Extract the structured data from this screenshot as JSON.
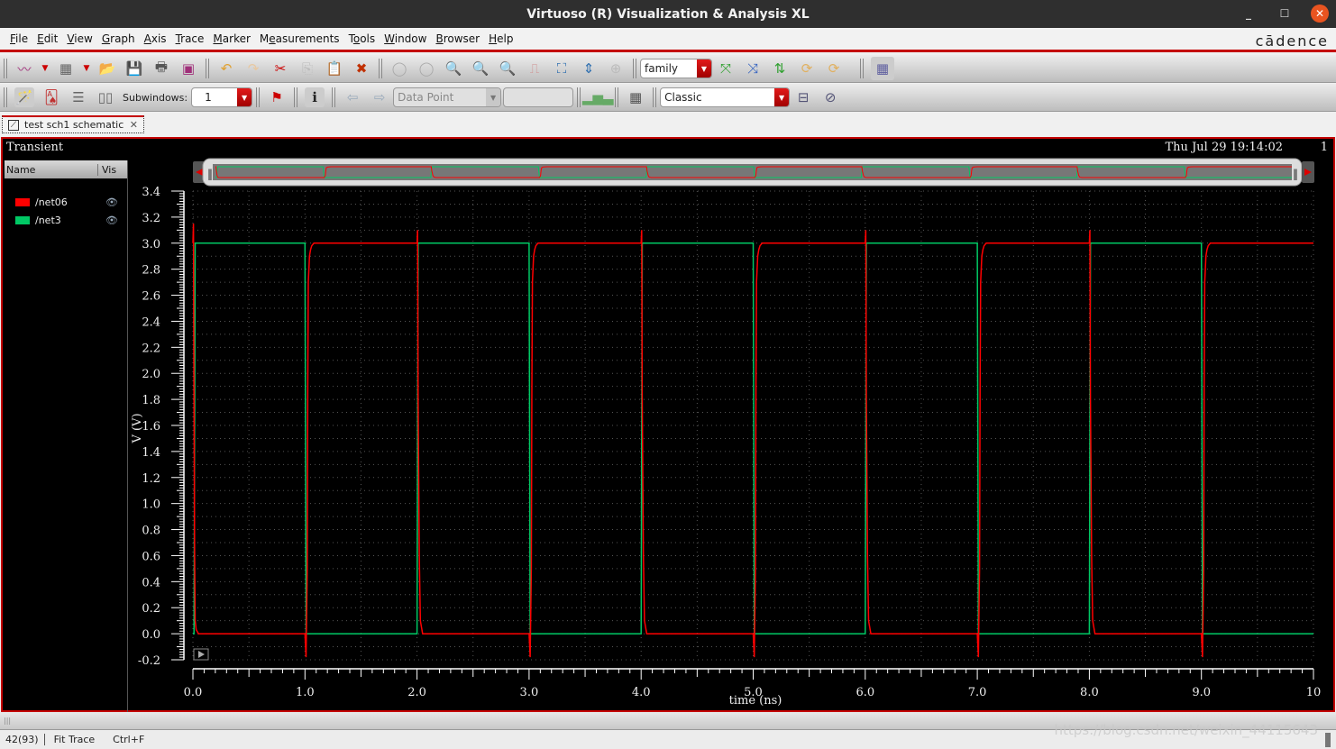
{
  "window": {
    "title": "Virtuoso (R) Visualization & Analysis XL",
    "controls": [
      "minimize",
      "maximize",
      "close"
    ]
  },
  "menubar": {
    "items": [
      "File",
      "Edit",
      "View",
      "Graph",
      "Axis",
      "Trace",
      "Marker",
      "Measurements",
      "Tools",
      "Window",
      "Browser",
      "Help"
    ],
    "brand": "cādence"
  },
  "toolbar1": {
    "family_combo": "family",
    "icons": [
      "new-window-icon",
      "new-subwindow-icon",
      "open-folder-icon",
      "save-icon",
      "print-icon",
      "print-waveform-icon",
      "undo-icon",
      "redo-icon",
      "cut-icon",
      "copy-icon",
      "paste-icon",
      "delete-icon",
      "back-icon",
      "forward-icon",
      "zoom-in-icon",
      "zoom-in-2-icon",
      "zoom-out-2-icon",
      "zoom-trace-icon",
      "fit-icon",
      "zoom-y-icon",
      "zoom-disabled-icon",
      "split-strips-icon",
      "combine-strips-icon",
      "strip-arrange-icon",
      "add-reference-icon",
      "reference-icon",
      "grid-icon"
    ]
  },
  "toolbar2": {
    "subwindows_label": "Subwindows:",
    "subwindows_value": "1",
    "data_point_placeholder": "Data Point",
    "style_combo": "Classic"
  },
  "tab": {
    "label": "test sch1 schematic"
  },
  "graph": {
    "analysis": "Transient",
    "datetime": "Thu Jul 29 19:14:02",
    "window_number": "1",
    "legend_header_name": "Name",
    "legend_header_vis": "Vis",
    "traces": [
      {
        "name": "/net06",
        "color": "#ff0000"
      },
      {
        "name": "/net3",
        "color": "#00c864"
      }
    ]
  },
  "chart_data": {
    "type": "line",
    "title": "Transient",
    "xlabel": "time (ns)",
    "ylabel": "V (V)",
    "xlim": [
      0,
      10
    ],
    "ylim": [
      -0.2,
      3.4
    ],
    "x_ticks": [
      "0.0",
      "1.0",
      "2.0",
      "3.0",
      "4.0",
      "5.0",
      "6.0",
      "7.0",
      "8.0",
      "9.0",
      "10"
    ],
    "y_ticks": [
      "3.4",
      "3.2",
      "3.0",
      "2.8",
      "2.6",
      "2.4",
      "2.2",
      "2.0",
      "1.8",
      "1.6",
      "1.4",
      "1.2",
      "1.0",
      "0.8",
      "0.6",
      "0.4",
      "0.2",
      "0.0",
      "-0.2"
    ],
    "grid": true,
    "legend": "left-panel",
    "series": [
      {
        "name": "/net3",
        "color": "#00c864",
        "x": [
          0,
          0.01,
          0.02,
          1.0,
          1.01,
          2.0,
          2.01,
          3.0,
          3.01,
          4.0,
          4.01,
          5.0,
          5.01,
          6.0,
          6.01,
          7.0,
          7.01,
          8.0,
          8.01,
          9.0,
          9.01,
          10.0
        ],
        "y": [
          0.0,
          0.0,
          3.0,
          3.0,
          0.0,
          0.0,
          3.0,
          3.0,
          0.0,
          0.0,
          3.0,
          3.0,
          0.0,
          0.0,
          3.0,
          3.0,
          0.0,
          0.0,
          3.0,
          3.0,
          0.0,
          0.0
        ]
      },
      {
        "name": "/net06",
        "color": "#ff0000",
        "x": [
          0,
          0.005,
          0.01,
          0.015,
          0.02,
          0.03,
          0.05,
          0.06,
          1.0,
          1.01,
          1.02,
          1.025,
          1.03,
          1.04,
          1.05,
          1.06,
          1.08,
          1.1,
          2.0,
          2.005,
          2.01,
          2.02,
          2.03,
          2.05,
          2.06,
          3.0,
          3.01,
          3.02,
          3.025,
          3.03,
          3.04,
          3.05,
          3.06,
          3.08,
          3.1,
          4.0,
          4.005,
          4.01,
          4.02,
          4.03,
          4.05,
          4.06,
          5.0,
          5.01,
          5.02,
          5.025,
          5.03,
          5.04,
          5.05,
          5.06,
          5.08,
          5.1,
          6.0,
          6.005,
          6.01,
          6.02,
          6.03,
          6.05,
          6.06,
          7.0,
          7.01,
          7.02,
          7.025,
          7.03,
          7.04,
          7.05,
          7.06,
          7.08,
          7.1,
          8.0,
          8.005,
          8.01,
          8.02,
          8.03,
          8.05,
          8.06,
          9.0,
          9.01,
          9.02,
          9.025,
          9.03,
          9.04,
          9.05,
          9.06,
          9.08,
          9.1,
          10.0
        ],
        "y": [
          3.0,
          3.15,
          1.8,
          0.6,
          0.1,
          0.03,
          0.0,
          0.0,
          0.0,
          -0.18,
          0.5,
          1.9,
          2.7,
          2.9,
          2.95,
          2.98,
          3.0,
          3.0,
          3.0,
          3.1,
          1.8,
          0.6,
          0.1,
          0.0,
          0.0,
          0.0,
          -0.18,
          0.5,
          1.9,
          2.7,
          2.9,
          2.95,
          2.98,
          3.0,
          3.0,
          3.0,
          3.1,
          1.8,
          0.6,
          0.1,
          0.0,
          0.0,
          0.0,
          -0.18,
          0.5,
          1.9,
          2.7,
          2.9,
          2.95,
          2.98,
          3.0,
          3.0,
          3.0,
          3.1,
          1.8,
          0.6,
          0.1,
          0.0,
          0.0,
          0.0,
          -0.18,
          0.5,
          1.9,
          2.7,
          2.9,
          2.95,
          2.98,
          3.0,
          3.0,
          3.0,
          3.1,
          1.8,
          0.6,
          0.1,
          0.0,
          0.0,
          0.0,
          -0.18,
          0.5,
          1.9,
          2.7,
          2.9,
          2.95,
          2.98,
          3.0,
          3.0,
          3.0
        ]
      }
    ]
  },
  "statusbar": {
    "count": "42(93)",
    "command": "Fit Trace",
    "shortcut": "Ctrl+F"
  },
  "watermark": "https://blog.csdn.net/weixin_44115643"
}
